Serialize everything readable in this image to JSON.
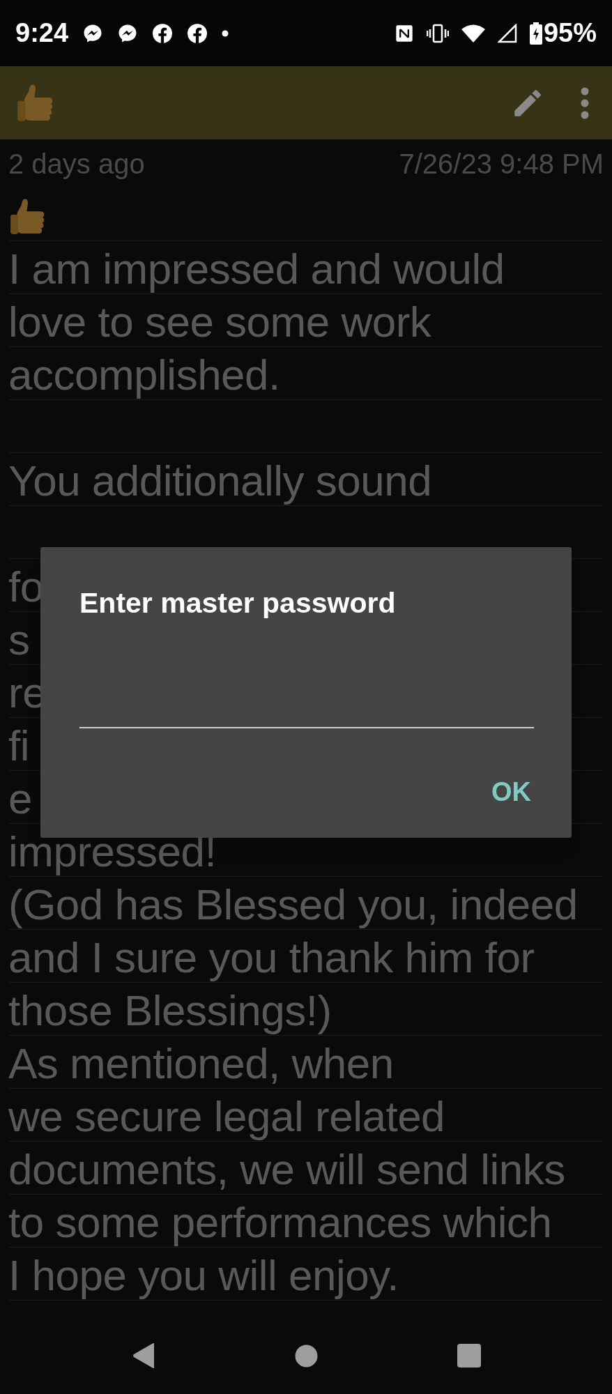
{
  "status_bar": {
    "time": "9:24",
    "battery": "95%"
  },
  "note": {
    "age": "2 days ago",
    "timestamp": "7/26/23 9:48 PM",
    "lines": [
      {
        "kind": "emoji"
      },
      {
        "kind": "text",
        "text": "I am impressed and would"
      },
      {
        "kind": "text",
        "text": "love to see some work"
      },
      {
        "kind": "text",
        "text": "accomplished."
      },
      {
        "kind": "blank"
      },
      {
        "kind": "text",
        "text": "You additionally sound"
      },
      {
        "kind": "blank"
      },
      {
        "kind": "text",
        "text": "fo"
      },
      {
        "kind": "text",
        "text": "s"
      },
      {
        "kind": "text",
        "text": "re"
      },
      {
        "kind": "text",
        "text": "fi"
      },
      {
        "kind": "text",
        "text": "e"
      },
      {
        "kind": "text",
        "text": "impressed!"
      },
      {
        "kind": "text",
        "text": "(God has Blessed you, indeed"
      },
      {
        "kind": "text",
        "text": "and I sure you thank him for"
      },
      {
        "kind": "text",
        "text": "those Blessings!)"
      },
      {
        "kind": "text",
        "text": "As mentioned, when"
      },
      {
        "kind": "text",
        "text": "we secure legal related"
      },
      {
        "kind": "text",
        "text": "documents, we will send links"
      },
      {
        "kind": "text",
        "text": "to some performances which"
      },
      {
        "kind": "text",
        "text": "I hope you will enjoy."
      }
    ]
  },
  "dialog": {
    "title": "Enter master password",
    "button": "OK"
  }
}
